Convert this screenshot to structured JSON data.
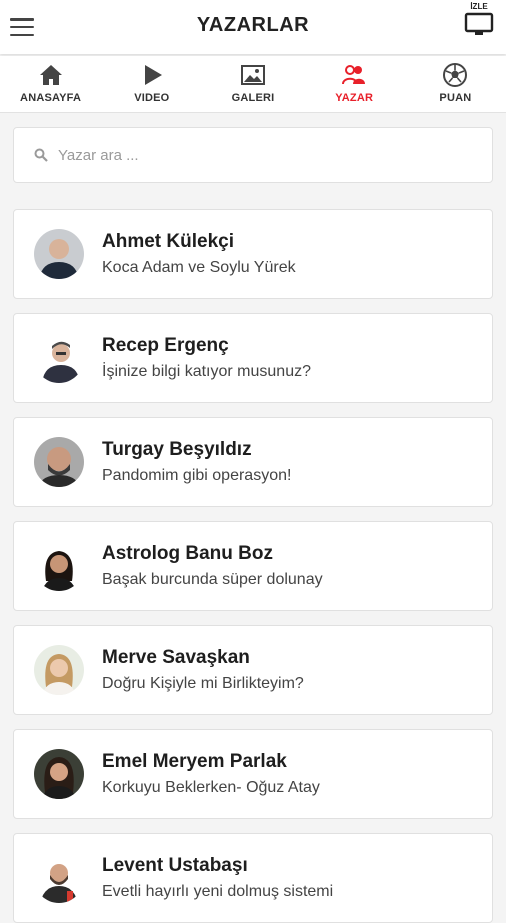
{
  "header": {
    "title": "YAZARLAR",
    "watch_label": "İZLE",
    "menu_icon": "hamburger-menu-icon",
    "watch_icon": "tv-screen-icon"
  },
  "tabs": [
    {
      "label": "ANASAYFA",
      "icon": "home-icon",
      "active": false
    },
    {
      "label": "VIDEO",
      "icon": "play-icon",
      "active": false
    },
    {
      "label": "GALERI",
      "icon": "gallery-icon",
      "active": false
    },
    {
      "label": "YAZAR",
      "icon": "authors-icon",
      "active": true
    },
    {
      "label": "PUAN",
      "icon": "soccer-ball-icon",
      "active": false
    }
  ],
  "search": {
    "placeholder": "Yazar ara ...",
    "value": ""
  },
  "authors": [
    {
      "name": "Ahmet Külekçi",
      "article": "Koca Adam ve Soylu Yürek"
    },
    {
      "name": "Recep Ergenç",
      "article": "İşinize bilgi katıyor musunuz?"
    },
    {
      "name": "Turgay Beşyıldız",
      "article": "Pandomim gibi operasyon!"
    },
    {
      "name": "Astrolog Banu Boz",
      "article": "Başak burcunda süper dolunay"
    },
    {
      "name": "Merve Savaşkan",
      "article": "Doğru Kişiyle mi Birlikteyim?"
    },
    {
      "name": "Emel Meryem Parlak",
      "article": "Korkuyu Beklerken- Oğuz Atay"
    },
    {
      "name": "Levent Ustabaşı",
      "article": "Evetli hayırlı yeni dolmuş sistemi"
    }
  ],
  "colors": {
    "accent": "#e8202a",
    "text": "#222222",
    "background": "#f4f4f4"
  }
}
